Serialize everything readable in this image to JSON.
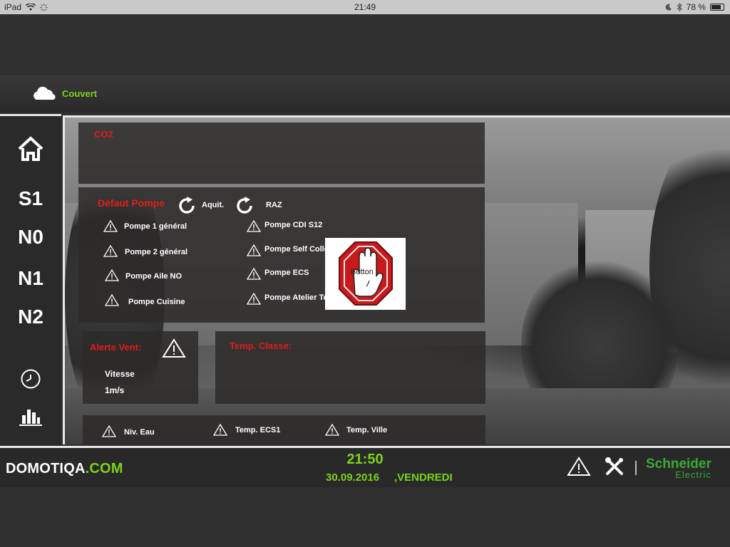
{
  "statusbar": {
    "device": "iPad",
    "time": "21:49",
    "battery": "78 %"
  },
  "weather": {
    "icon": "cloud-icon",
    "label": "Couvert"
  },
  "sidebar": {
    "items": [
      {
        "name": "home",
        "icon": "home-icon"
      },
      {
        "label": "S1"
      },
      {
        "label": "N0"
      },
      {
        "label": "N1"
      },
      {
        "label": "N2"
      },
      {
        "name": "clock",
        "icon": "clock-icon"
      },
      {
        "name": "stats",
        "icon": "bar-chart-icon"
      }
    ]
  },
  "co2": {
    "title": "CO2"
  },
  "pump": {
    "title": "Défaut Pompe",
    "ack_label": "Aquit.",
    "reset_label": "RAZ",
    "left": [
      "Pompe 1 général",
      "Pompe 2 général",
      "Pompe Aile NO",
      "Pompe Cuisine"
    ],
    "right": [
      "Pompe CDI S12",
      "Pompe Self Collè",
      "Pompe ECS",
      "Pompe Atelier Tec"
    ]
  },
  "stop_button": {
    "label": "Button",
    "icon": "stop-hand-icon"
  },
  "wind": {
    "title": "Alerte Vent:",
    "speed_label": "Vitesse",
    "speed_value": "1m/s"
  },
  "classroom": {
    "title": "Temp. Classe:"
  },
  "bottom_alarms": [
    "Niv. Eau",
    "Temp. ECS1",
    "Temp. Ville"
  ],
  "footer": {
    "brand": "DOMOTIQA",
    "brand_suffix": ".COM",
    "time": "21:50",
    "date": "30.09.2016",
    "day": ",VENDREDI",
    "vendor": "Schneider",
    "vendor_sub": "Electric"
  },
  "colors": {
    "accent": "#7bd11f",
    "alert": "#e21c1c",
    "vendor": "#3aa935"
  }
}
